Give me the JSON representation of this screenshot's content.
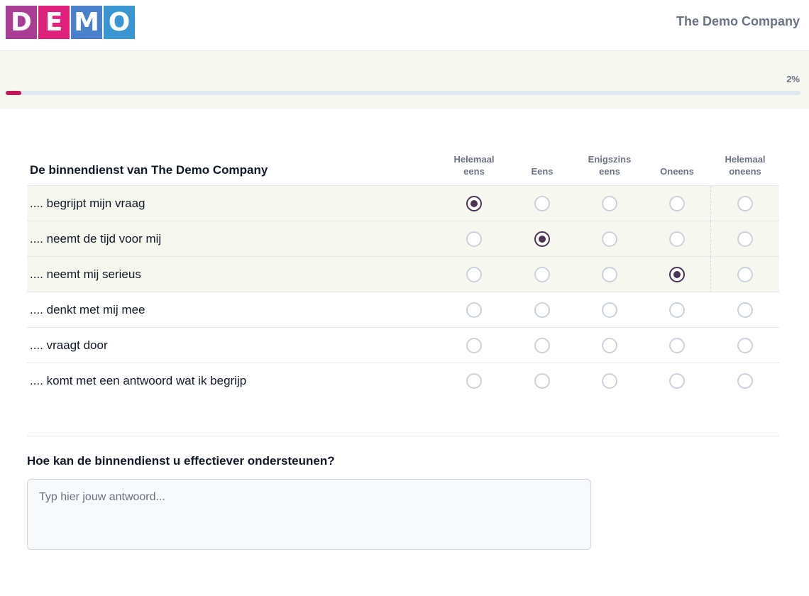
{
  "header": {
    "logo_letters": [
      {
        "letter": "D",
        "color": "#a93d93"
      },
      {
        "letter": "E",
        "color": "#e0217b"
      },
      {
        "letter": "M",
        "color": "#4b80cc"
      },
      {
        "letter": "O",
        "color": "#3a96d2"
      }
    ],
    "company_name": "The Demo Company"
  },
  "progress": {
    "label": "2%",
    "value": 0.02,
    "color": "#c2185b"
  },
  "matrix": {
    "title": "De binnendienst van The Demo Company",
    "columns": [
      {
        "line1": "Helemaal",
        "line2": "eens"
      },
      {
        "line1": "",
        "line2": "Eens"
      },
      {
        "line1": "Enigszins",
        "line2": "eens"
      },
      {
        "line1": "",
        "line2": "Oneens"
      },
      {
        "line1": "Helemaal",
        "line2": "oneens"
      }
    ],
    "rows": [
      {
        "label": ".... begrijpt mijn vraag",
        "selected": 0
      },
      {
        "label": ".... neemt de tijd voor mij",
        "selected": 1
      },
      {
        "label": ".... neemt mij serieus",
        "selected": 3
      },
      {
        "label": ".... denkt met mij mee",
        "selected": null
      },
      {
        "label": ".... vraagt door",
        "selected": null
      },
      {
        "label": ".... komt met een antwoord wat ik begrijp",
        "selected": null
      }
    ]
  },
  "open_question": {
    "label": "Hoe kan de binnendienst u effectiever ondersteunen?",
    "value": "",
    "placeholder": "Typ hier jouw antwoord..."
  }
}
